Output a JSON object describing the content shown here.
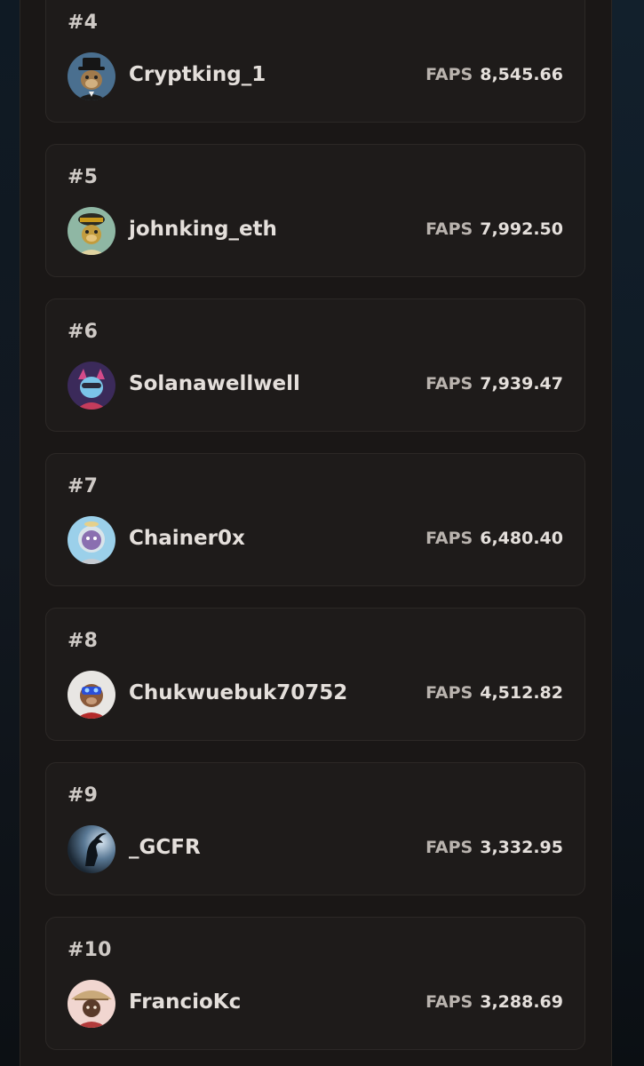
{
  "leaderboard": {
    "score_label": "FAPS",
    "entries": [
      {
        "rank": "#4",
        "username": "Cryptking_1",
        "score": "8,545.66",
        "avatar": "ape-tophat-avatar"
      },
      {
        "rank": "#5",
        "username": "johnking_eth",
        "score": "7,992.50",
        "avatar": "ape-yellow-hat-avatar"
      },
      {
        "rank": "#6",
        "username": "Solanawellwell",
        "score": "7,939.47",
        "avatar": "purple-character-avatar"
      },
      {
        "rank": "#7",
        "username": "Chainer0x",
        "score": "6,480.40",
        "avatar": "astronaut-avatar"
      },
      {
        "rank": "#8",
        "username": "Chukwuebuk70752",
        "score": "4,512.82",
        "avatar": "ape-goggles-avatar"
      },
      {
        "rank": "#9",
        "username": "_GCFR",
        "score": "3,332.95",
        "avatar": "goat-silhouette-avatar"
      },
      {
        "rank": "#10",
        "username": "FrancioKc",
        "score": "3,288.69",
        "avatar": "samurai-hat-avatar"
      }
    ]
  }
}
